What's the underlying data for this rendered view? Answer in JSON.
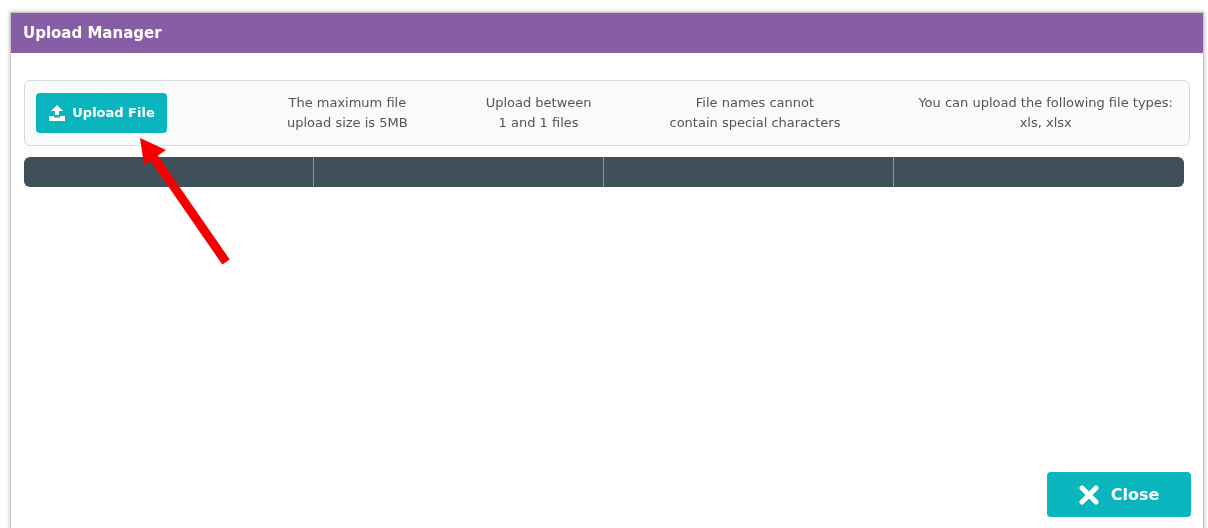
{
  "dialog": {
    "title": "Upload Manager"
  },
  "upload_button": {
    "label": "Upload File"
  },
  "notes": [
    {
      "line1": "The maximum file",
      "line2": "upload size is 5MB"
    },
    {
      "line1": "Upload between",
      "line2": "1 and 1 files"
    },
    {
      "line1": "File names cannot",
      "line2": "contain special characters"
    },
    {
      "line1": "You can upload the following file types:",
      "line2": "xls, xlsx"
    }
  ],
  "close_button": {
    "label": "Close"
  }
}
